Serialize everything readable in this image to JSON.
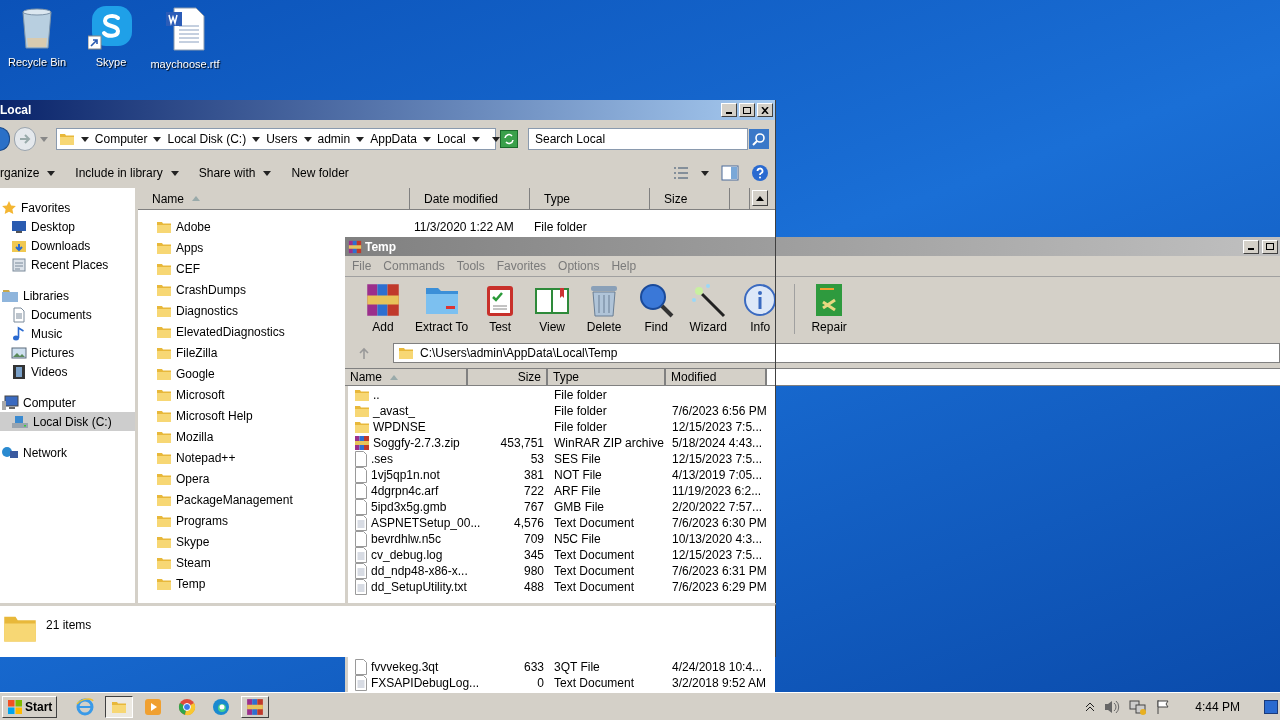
{
  "desktop_icons": [
    {
      "label": "Recycle Bin",
      "kind": "recycle"
    },
    {
      "label": "Skype",
      "kind": "skype"
    },
    {
      "label": "maychoose.rtf",
      "kind": "word"
    }
  ],
  "explorer": {
    "title": "Local",
    "breadcrumb": [
      "Computer",
      "Local Disk (C:)",
      "Users",
      "admin",
      "AppData",
      "Local"
    ],
    "search": {
      "placeholder": "Search Local"
    },
    "commands": [
      {
        "label": "rganize",
        "menu": true
      },
      {
        "label": "Include in library",
        "menu": true
      },
      {
        "label": "Share with",
        "menu": true
      },
      {
        "label": "New folder",
        "menu": false
      }
    ],
    "nav": [
      {
        "label": "Favorites",
        "kind": "star",
        "selected": false,
        "children": [
          {
            "label": "Desktop",
            "kind": "desktop",
            "selected": false
          },
          {
            "label": "Downloads",
            "kind": "downloads",
            "selected": false
          },
          {
            "label": "Recent Places",
            "kind": "recent",
            "selected": false
          }
        ]
      },
      {
        "label": "Libraries",
        "kind": "library",
        "selected": false,
        "children": [
          {
            "label": "Documents",
            "kind": "document",
            "selected": false
          },
          {
            "label": "Music",
            "kind": "music",
            "selected": false
          },
          {
            "label": "Pictures",
            "kind": "picture",
            "selected": false
          },
          {
            "label": "Videos",
            "kind": "video",
            "selected": false
          }
        ]
      },
      {
        "label": "Computer",
        "kind": "computer",
        "selected": false,
        "children": [
          {
            "label": "Local Disk (C:)",
            "kind": "disk",
            "selected": true
          }
        ]
      },
      {
        "label": "Network",
        "kind": "network",
        "selected": false
      }
    ],
    "columns": [
      {
        "label": "Name",
        "sorted": true
      },
      {
        "label": "Date modified",
        "sorted": false
      },
      {
        "label": "Type",
        "sorted": false
      },
      {
        "label": "Size",
        "sorted": false
      }
    ],
    "rows": [
      {
        "name": "Adobe",
        "date_modified": "11/3/2020 1:22 AM",
        "type": "File folder"
      },
      {
        "name": "Apps"
      },
      {
        "name": "CEF"
      },
      {
        "name": "CrashDumps"
      },
      {
        "name": "Diagnostics"
      },
      {
        "name": "ElevatedDiagnostics"
      },
      {
        "name": "FileZilla"
      },
      {
        "name": "Google"
      },
      {
        "name": "Microsoft"
      },
      {
        "name": "Microsoft Help"
      },
      {
        "name": "Mozilla"
      },
      {
        "name": "Notepad++"
      },
      {
        "name": "Opera"
      },
      {
        "name": "PackageManagement"
      },
      {
        "name": "Programs"
      },
      {
        "name": "Skype"
      },
      {
        "name": "Steam"
      },
      {
        "name": "Temp"
      }
    ],
    "status": "21 items"
  },
  "winrar": {
    "title": "Temp",
    "menu": [
      "File",
      "Commands",
      "Tools",
      "Favorites",
      "Options",
      "Help"
    ],
    "toolbar": [
      {
        "label": "Add",
        "kind": "add"
      },
      {
        "label": "Extract To",
        "kind": "extract"
      },
      {
        "label": "Test",
        "kind": "test"
      },
      {
        "label": "View",
        "kind": "view"
      },
      {
        "label": "Delete",
        "kind": "delete"
      },
      {
        "label": "Find",
        "kind": "find"
      },
      {
        "label": "Wizard",
        "kind": "wizard"
      },
      {
        "label": "Info",
        "kind": "info"
      },
      {
        "label": "Repair",
        "kind": "repair"
      }
    ],
    "path": "C:\\Users\\admin\\AppData\\Local\\Temp",
    "columns": [
      {
        "label": "Name",
        "sorted": true
      },
      {
        "label": "Size",
        "sorted": false
      },
      {
        "label": "Type",
        "sorted": false
      },
      {
        "label": "Modified",
        "sorted": false
      }
    ],
    "rows": [
      {
        "name": "..",
        "kind": "folder",
        "type": "File folder"
      },
      {
        "name": "_avast_",
        "kind": "folder",
        "type": "File folder",
        "modified": "7/6/2023 6:56 PM"
      },
      {
        "name": "WPDNSE",
        "kind": "folder",
        "type": "File folder",
        "modified": "12/15/2023 7:5..."
      },
      {
        "name": "Soggfy-2.7.3.zip",
        "kind": "archive",
        "size": "453,751",
        "type": "WinRAR ZIP archive",
        "modified": "5/18/2024 4:43..."
      },
      {
        "name": ".ses",
        "kind": "file",
        "size": "53",
        "type": "SES File",
        "modified": "12/15/2023 7:5..."
      },
      {
        "name": "1vj5qp1n.not",
        "kind": "file",
        "size": "381",
        "type": "NOT File",
        "modified": "4/13/2019 7:05..."
      },
      {
        "name": "4dgrpn4c.arf",
        "kind": "file",
        "size": "722",
        "type": "ARF File",
        "modified": "11/19/2023 6:2..."
      },
      {
        "name": "5ipd3x5g.gmb",
        "kind": "file",
        "size": "767",
        "type": "GMB File",
        "modified": "2/20/2022 7:57..."
      },
      {
        "name": "ASPNETSetup_00...",
        "kind": "text",
        "size": "4,576",
        "type": "Text Document",
        "modified": "7/6/2023 6:30 PM"
      },
      {
        "name": "bevrdhlw.n5c",
        "kind": "file",
        "size": "709",
        "type": "N5C File",
        "modified": "10/13/2020 4:3..."
      },
      {
        "name": "cv_debug.log",
        "kind": "text",
        "size": "345",
        "type": "Text Document",
        "modified": "12/15/2023 7:5..."
      },
      {
        "name": "dd_ndp48-x86-x...",
        "kind": "text",
        "size": "980",
        "type": "Text Document",
        "modified": "7/6/2023 6:31 PM"
      },
      {
        "name": "dd_SetupUtility.txt",
        "kind": "text",
        "size": "488",
        "type": "Text Document",
        "modified": "7/6/2023 6:29 PM"
      }
    ],
    "rows_below": [
      {
        "name": "fvvvekeg.3qt",
        "kind": "file",
        "size": "633",
        "type": "3QT File",
        "modified": "4/24/2018 10:4..."
      },
      {
        "name": "FXSAPIDebugLog...",
        "kind": "text",
        "size": "0",
        "type": "Text Document",
        "modified": "3/2/2018 9:52 AM"
      }
    ]
  },
  "taskbar": {
    "start": "Start",
    "apps": [
      {
        "kind": "ie",
        "selected": false
      },
      {
        "kind": "explorer",
        "selected": true
      },
      {
        "kind": "media",
        "selected": false
      },
      {
        "kind": "chrome",
        "selected": false
      },
      {
        "kind": "edge",
        "selected": false
      },
      {
        "kind": "winrar",
        "selected": false
      }
    ],
    "tray": [
      {
        "kind": "chevron"
      },
      {
        "kind": "volume"
      },
      {
        "kind": "network"
      },
      {
        "kind": "flag"
      }
    ],
    "clock": "4:44 PM"
  }
}
